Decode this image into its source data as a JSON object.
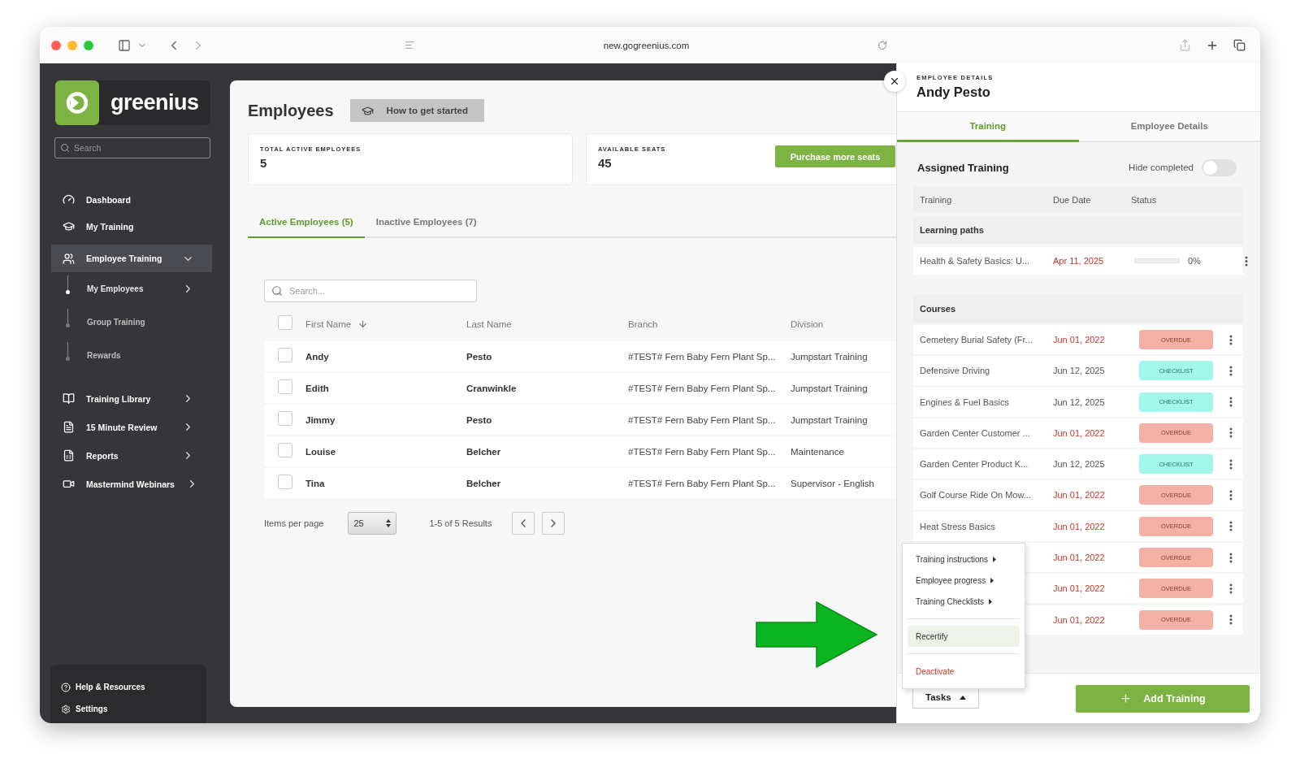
{
  "browser": {
    "url": "new.gogreenius.com"
  },
  "sidebar": {
    "logo": "greenius",
    "search": {
      "placeholder": "Search"
    },
    "items": [
      {
        "label": "Dashboard",
        "selected": false
      },
      {
        "label": "My Training",
        "selected": false
      },
      {
        "label": "Employee Training",
        "selected": true,
        "expanded": true,
        "children": [
          {
            "label": "My Employees",
            "selected": true,
            "expanded": false
          },
          {
            "label": "Group Training",
            "selected": false
          },
          {
            "label": "Rewards",
            "selected": false
          }
        ]
      },
      {
        "label": "Training Library",
        "selected": false,
        "expanded": false
      },
      {
        "label": "15 Minute Review",
        "selected": false,
        "expanded": false
      },
      {
        "label": "Reports",
        "selected": false,
        "expanded": false
      },
      {
        "label": "Mastermind Webinars",
        "selected": false,
        "expanded": false
      }
    ],
    "footer_items": [
      {
        "label": "Help & Resources"
      },
      {
        "label": "Settings"
      }
    ]
  },
  "main": {
    "title": "Employees",
    "help_button": "How to get started",
    "stats": [
      {
        "label": "TOTAL ACTIVE EMPLOYEES",
        "value": "5"
      },
      {
        "label": "AVAILABLE SEATS",
        "value": "45",
        "button": "Purchase more seats"
      }
    ],
    "tabs": [
      {
        "label": "Active Employees (5)",
        "selected": true
      },
      {
        "label": "Inactive Employees (7)",
        "selected": false
      }
    ],
    "search": {
      "placeholder": "Search..."
    },
    "table": {
      "all_checked": false,
      "columns": [
        {
          "label": "First Name",
          "sorted": true
        },
        {
          "label": "Last Name",
          "sorted": false
        },
        {
          "label": "Branch",
          "sorted": false
        },
        {
          "label": "Division",
          "sorted": false
        }
      ],
      "rows": [
        {
          "first": "Andy",
          "last": "Pesto",
          "branch": "#TEST# Fern Baby Fern Plant Sp...",
          "division": "Jumpstart Training",
          "checked": false
        },
        {
          "first": "Edith",
          "last": "Cranwinkle",
          "branch": "#TEST# Fern Baby Fern Plant Sp...",
          "division": "Jumpstart Training",
          "checked": false
        },
        {
          "first": "Jimmy",
          "last": "Pesto",
          "branch": "#TEST# Fern Baby Fern Plant Sp...",
          "division": "Jumpstart Training",
          "checked": false
        },
        {
          "first": "Louise",
          "last": "Belcher",
          "branch": "#TEST# Fern Baby Fern Plant Sp...",
          "division": "Maintenance",
          "checked": false
        },
        {
          "first": "Tina",
          "last": "Belcher",
          "branch": "#TEST# Fern Baby Fern Plant Sp...",
          "division": "Supervisor - English",
          "checked": false
        }
      ]
    },
    "pagination": {
      "label": "Items per page",
      "page_size": "25",
      "results": "1-5 of 5 Results"
    }
  },
  "drawer": {
    "eyebrow": "EMPLOYEE DETAILS",
    "name": "Andy Pesto",
    "tabs": [
      {
        "label": "Training",
        "selected": true
      },
      {
        "label": "Employee Details",
        "selected": false
      }
    ],
    "section_title": "Assigned Training",
    "hide_completed": {
      "label": "Hide completed",
      "on": false
    },
    "columns": [
      "Training",
      "Due Date",
      "Status"
    ],
    "learning_paths": {
      "title": "Learning paths",
      "items": [
        {
          "name": "Health & Safety Basics: U...",
          "due": "Apr 11, 2025",
          "overdue": true,
          "level": 0,
          "reading": "0%"
        }
      ]
    },
    "courses": {
      "title": "Courses",
      "items": [
        {
          "name": "Cemetery Burial Safety (Fr...",
          "due": "Jun 01, 2022",
          "overdue": true,
          "status": "OVERDUE",
          "kind": "overdue"
        },
        {
          "name": "Defensive Driving",
          "due": "Jun 12, 2025",
          "overdue": false,
          "status": "CHECKLIST",
          "kind": "checklist"
        },
        {
          "name": "Engines & Fuel Basics",
          "due": "Jun 12, 2025",
          "overdue": false,
          "status": "CHECKLIST",
          "kind": "checklist"
        },
        {
          "name": "Garden Center Customer ...",
          "due": "Jun 01, 2022",
          "overdue": true,
          "status": "OVERDUE",
          "kind": "overdue"
        },
        {
          "name": "Garden Center Product K...",
          "due": "Jun 12, 2025",
          "overdue": false,
          "status": "CHECKLIST",
          "kind": "checklist"
        },
        {
          "name": "Golf Course Ride On Mow...",
          "due": "Jun 01, 2022",
          "overdue": true,
          "status": "OVERDUE",
          "kind": "overdue"
        },
        {
          "name": "Heat Stress Basics",
          "due": "Jun 01, 2022",
          "overdue": true,
          "status": "OVERDUE",
          "kind": "overdue"
        },
        {
          "due": "Jun 01, 2022",
          "overdue": true,
          "status": "OVERDUE",
          "kind": "overdue"
        },
        {
          "due": "Jun 01, 2022",
          "overdue": true,
          "status": "OVERDUE",
          "kind": "overdue"
        },
        {
          "due": "Jun 01, 2022",
          "overdue": true,
          "status": "OVERDUE",
          "kind": "overdue"
        }
      ]
    },
    "tasks_button": {
      "label": "Tasks",
      "expanded": true
    },
    "add_button": "Add Training"
  },
  "tasks_menu": {
    "items": [
      {
        "label": "Training instructions",
        "kind": "submenu",
        "selected": false
      },
      {
        "label": "Employee progress",
        "kind": "submenu",
        "selected": false
      },
      {
        "label": "Training Checklists",
        "kind": "submenu",
        "selected": false
      },
      {
        "label": "Recertify",
        "kind": "action",
        "selected": true
      },
      {
        "label": "Deactivate",
        "kind": "danger",
        "selected": false
      }
    ]
  }
}
